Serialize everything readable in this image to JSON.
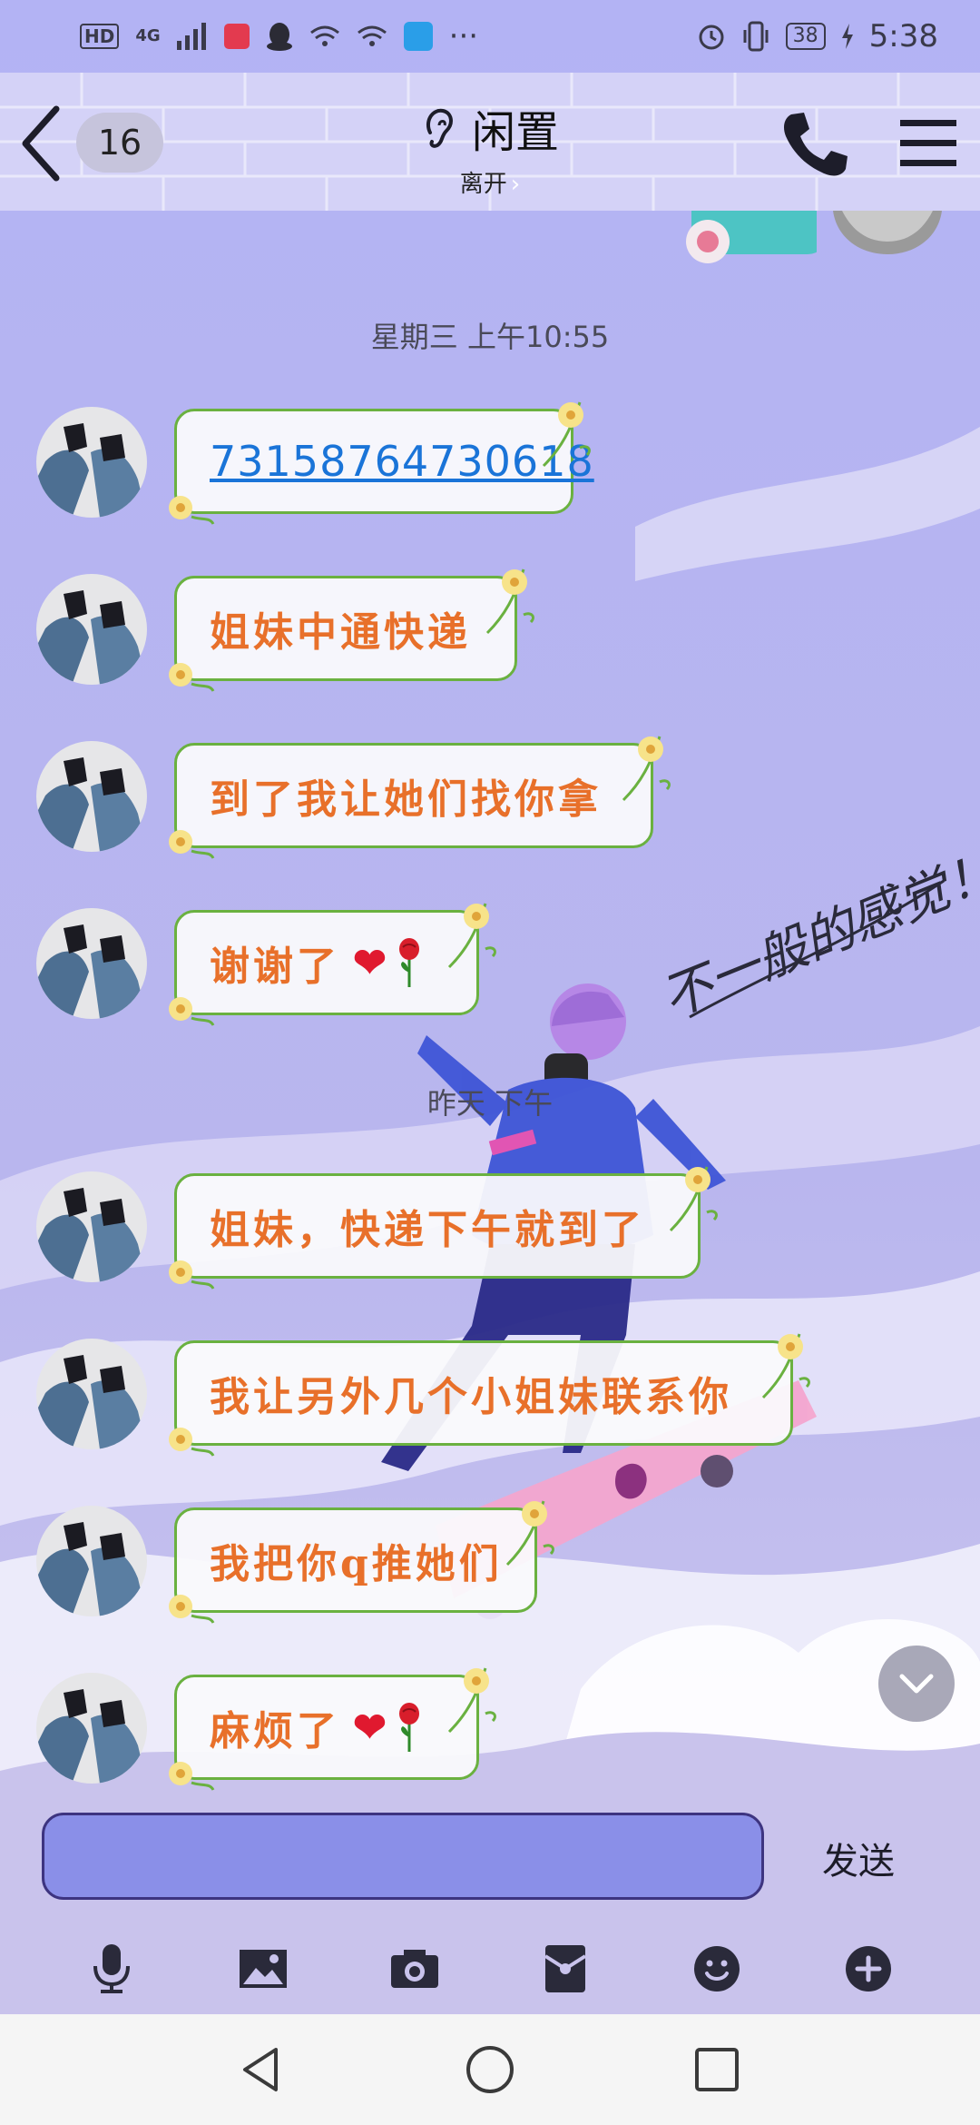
{
  "status_bar": {
    "hd": "HD",
    "network": "4G",
    "more": "···",
    "battery": "38",
    "time": "5:38"
  },
  "header": {
    "unread_count": "16",
    "title": "闲置",
    "status": "离开",
    "status_chevron": "›"
  },
  "conversation": {
    "timestamp_1": "星期三 上午10:55",
    "timestamp_2": "昨天 下午",
    "messages": [
      {
        "text": "7315876473061​8"
      },
      {
        "text": "姐妹中通快递"
      },
      {
        "text": "到了我让她们找你拿"
      },
      {
        "text": "谢谢了",
        "heart": "❤"
      },
      {
        "text": "姐妹，快递下午就到了"
      },
      {
        "text": "我让另外几个小姐妹联系你"
      },
      {
        "text": "我把你q推她们"
      },
      {
        "text": "麻烦了",
        "heart": "❤"
      }
    ]
  },
  "graffiti_text": "不一般的感觉！",
  "composer": {
    "input_value": "",
    "send_label": "发送"
  },
  "toolbar": {
    "items": [
      "microphone-icon",
      "image-icon",
      "camera-icon",
      "red-packet-icon",
      "emoji-icon",
      "plus-icon"
    ]
  },
  "colors": {
    "bubble_text": "#e8702a",
    "link_text": "#1a74d8",
    "bubble_border": "#6ab140",
    "input_fill": "#8a8fe8",
    "background": "#b9b8f2"
  }
}
